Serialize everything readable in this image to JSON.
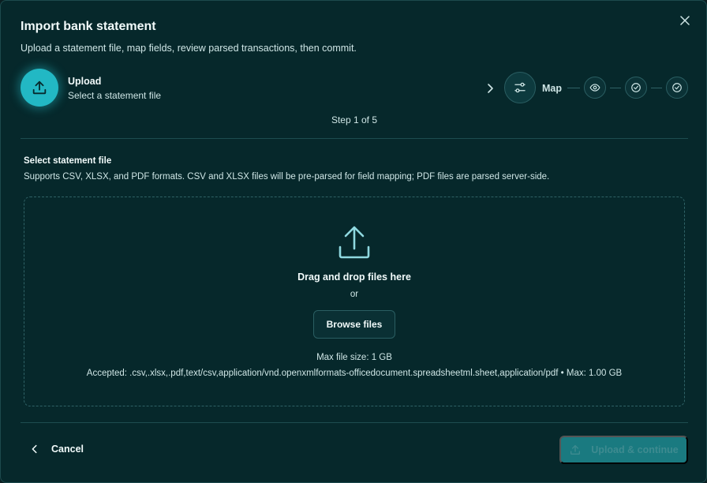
{
  "dialog": {
    "title": "Import bank statement",
    "subtitle": "Upload a statement file, map fields, review parsed transactions, then commit."
  },
  "stepper": {
    "current": {
      "title": "Upload",
      "description": "Select a statement file",
      "icon": "upload-icon"
    },
    "next": {
      "label": "Map",
      "icon": "sliders-icon"
    },
    "remaining_icons": [
      "eye-icon",
      "check-circle-icon",
      "check-circle-icon"
    ],
    "counter": "Step 1 of 5"
  },
  "section": {
    "title": "Select statement file",
    "description": "Supports CSV, XLSX, and PDF formats. CSV and XLSX files will be pre-parsed for field mapping; PDF files are parsed server-side."
  },
  "dropzone": {
    "title": "Drag and drop files here",
    "or": "or",
    "browse_label": "Browse files",
    "max_size": "Max file size: 1 GB",
    "accepted": "Accepted: .csv,.xlsx,.pdf,text/csv,application/vnd.openxmlformats-officedocument.spreadsheetml.sheet,application/pdf • Max: 1.00 GB"
  },
  "footer": {
    "cancel_label": "Cancel",
    "primary_label": "Upload & continue"
  },
  "colors": {
    "background": "#06282b",
    "accent": "#22b8c4",
    "primary_disabled": "#1a7a80"
  }
}
